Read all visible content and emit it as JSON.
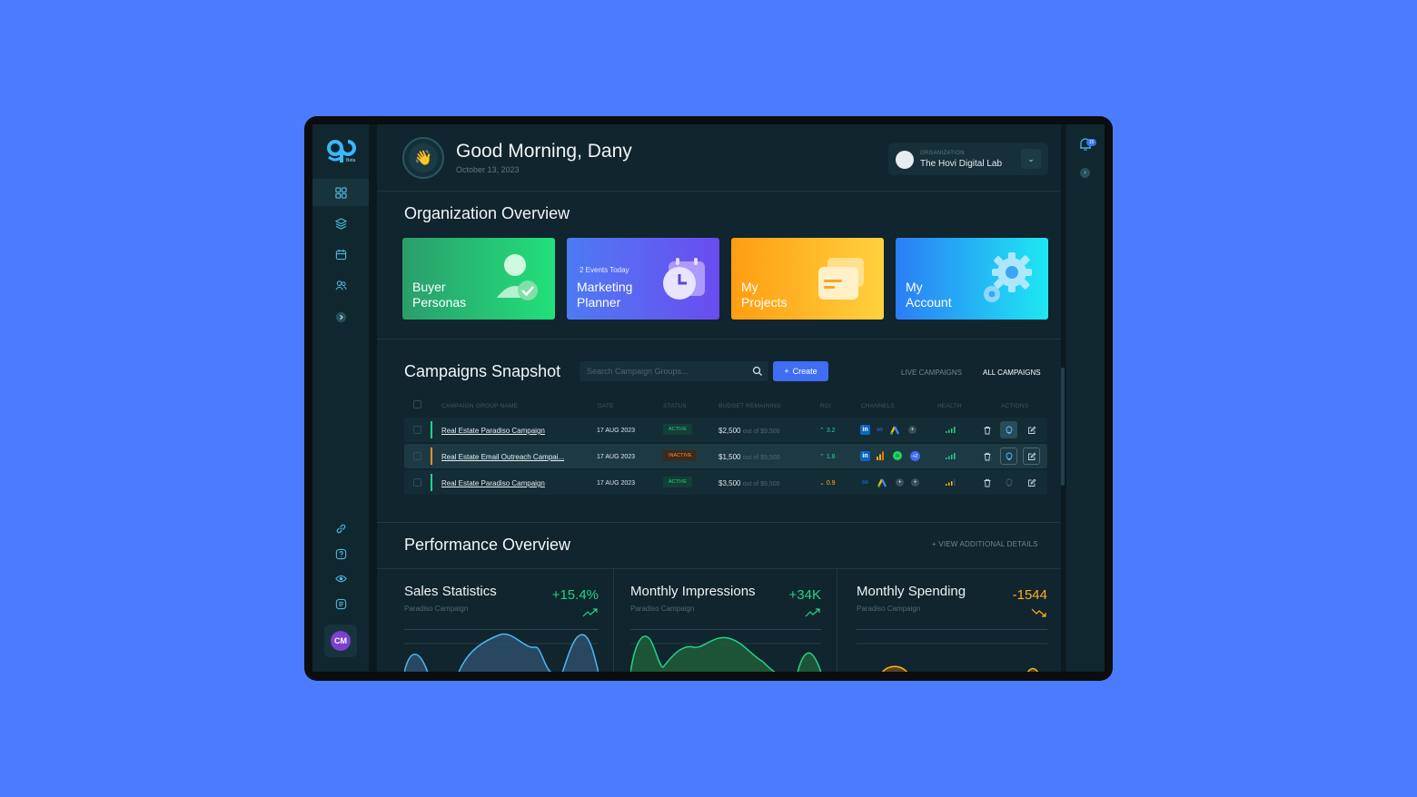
{
  "colors": {
    "background": "#4b7cff",
    "panel": "#10252d",
    "accent_blue": "#3f6ef5",
    "positive": "#22d487",
    "negative": "#ffb01f"
  },
  "brand": {
    "logo_text": "go",
    "logo_badge": "Beta"
  },
  "sidebar": {
    "items": [
      {
        "icon": "dashboard-icon"
      },
      {
        "icon": "layers-icon"
      },
      {
        "icon": "calendar-icon"
      },
      {
        "icon": "users-icon"
      },
      {
        "icon": "chevron-right-icon"
      }
    ],
    "bottom_items": [
      {
        "icon": "link-icon"
      },
      {
        "icon": "help-icon"
      },
      {
        "icon": "eye-icon"
      },
      {
        "icon": "document-icon"
      }
    ],
    "avatar_initials": "CM"
  },
  "header": {
    "greeting": "Good Morning, Dany",
    "date": "October 13, 2023",
    "organization_label": "ORGANIZATION",
    "organization_name": "The Hovi Digital Lab"
  },
  "overview": {
    "title": "Organization Overview",
    "cards": [
      {
        "label": "Buyer\nPersonas",
        "sub": ""
      },
      {
        "label": "Marketing\nPlanner",
        "sub": "2 Events Today"
      },
      {
        "label": "My\nProjects",
        "sub": ""
      },
      {
        "label": "My\nAccount",
        "sub": ""
      }
    ]
  },
  "campaigns": {
    "title": "Campaigns Snapshot",
    "search_placeholder": "Search Campaign Groups...",
    "create_label": "Create",
    "tabs": {
      "live": "LIVE CAMPAIGNS",
      "all": "ALL CAMPAIGNS"
    },
    "columns": [
      "CAMPAIGN GROUP NAME",
      "DATE",
      "STATUS",
      "BUDGET REMAINING",
      "ROI",
      "CHANNELS",
      "HEALTH",
      "ACTIONS"
    ],
    "rows": [
      {
        "name": "Real Estate Paradiso Campaign",
        "date": "17 AUG 2023",
        "status": "ACTIVE",
        "budget": "$2,500",
        "budget_of": "out of $9,500",
        "roi": "3.2",
        "roi_dir": "up",
        "bar_color": "#22d487"
      },
      {
        "name": "Real Estate Email Outreach Campai...",
        "date": "17 AUG 2023",
        "status": "INACTIVE",
        "budget": "$1,500",
        "budget_of": "out of $9,500",
        "roi": "1.8",
        "roi_dir": "up",
        "bar_color": "#ff8d2a"
      },
      {
        "name": "Real Estate Paradiso Campaign",
        "date": "17 AUG 2023",
        "status": "ACTIVE",
        "budget": "$3,500",
        "budget_of": "out of $9,500",
        "roi": "0.9",
        "roi_dir": "down",
        "bar_color": "#22d487"
      }
    ]
  },
  "performance": {
    "title": "Performance Overview",
    "view_more": "VIEW ADDITIONAL DETAILS",
    "panels": [
      {
        "title": "Sales Statistics",
        "sub": "Paradiso Campaign",
        "value": "+15.4%",
        "trend": "up"
      },
      {
        "title": "Monthly Impressions",
        "sub": "Paradiso Campaign",
        "value": "+34K",
        "trend": "up"
      },
      {
        "title": "Monthly Spending",
        "sub": "Paradiso Campaign",
        "value": "-1544",
        "trend": "down"
      }
    ]
  },
  "notifications": {
    "count": "15"
  }
}
